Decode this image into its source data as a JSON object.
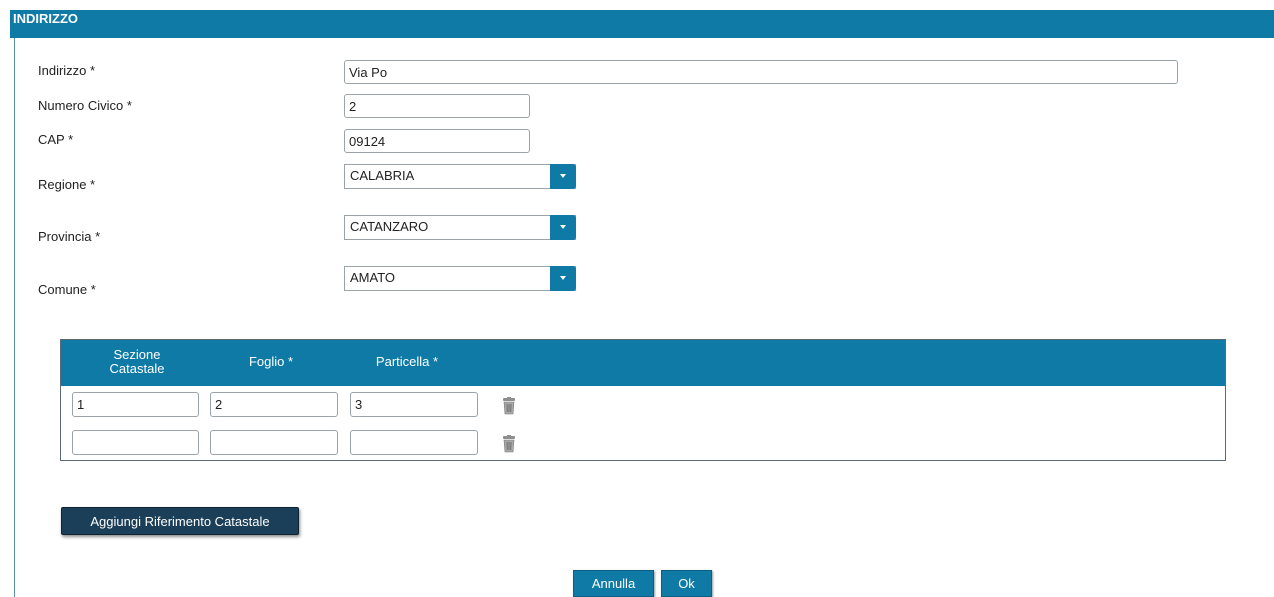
{
  "section": {
    "title": "INDIRIZZO"
  },
  "form": {
    "indirizzo": {
      "label": "Indirizzo *",
      "value": "Via Po"
    },
    "numero_civico": {
      "label": "Numero Civico *",
      "value": "2"
    },
    "cap": {
      "label": "CAP *",
      "value": "09124"
    },
    "regione": {
      "label": "Regione *",
      "value": "CALABRIA"
    },
    "provincia": {
      "label": "Provincia *",
      "value": "CATANZARO"
    },
    "comune": {
      "label": "Comune *",
      "value": "AMATO"
    }
  },
  "catasto": {
    "headers": {
      "sezione_line1": "Sezione",
      "sezione_line2": "Catastale",
      "foglio": "Foglio *",
      "particella": "Particella *"
    },
    "rows": [
      {
        "sezione": "1",
        "foglio": "2",
        "particella": "3"
      },
      {
        "sezione": "",
        "foglio": "",
        "particella": ""
      }
    ]
  },
  "actions": {
    "add_label": "Aggiungi Riferimento Catastale",
    "cancel_label": "Annulla",
    "ok_label": "Ok"
  },
  "colors": {
    "accent": "#0f7aa6",
    "dark_button": "#1b3f58"
  }
}
